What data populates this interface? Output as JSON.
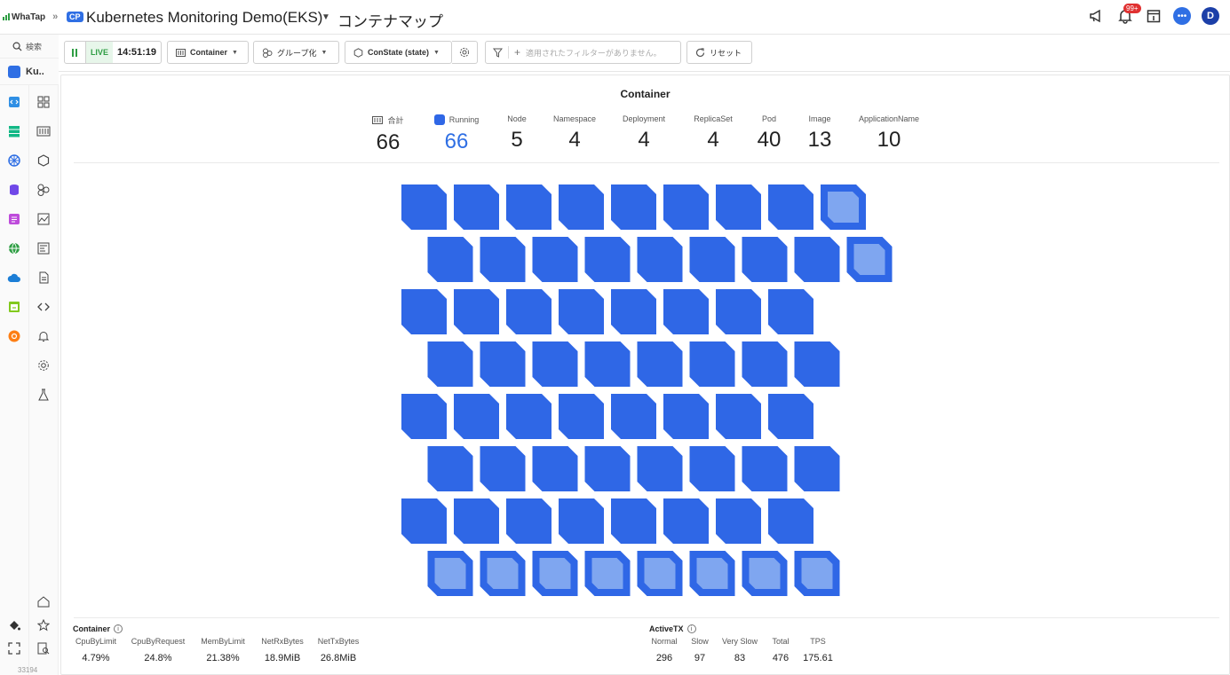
{
  "brand": {
    "logo_text": "WhaTap",
    "cp_badge": "CP"
  },
  "header": {
    "project_title": "Kubernetes Monitoring Demo(EKS)",
    "page_title": "コンテナマップ",
    "notification_count": "99+",
    "avatar_letter": "D"
  },
  "sidebar": {
    "search_label": "検索",
    "project_short": "Ku..",
    "footer_number": "33194"
  },
  "toolbar": {
    "live_label": "LIVE",
    "live_time": "14:51:19",
    "type_select": "Container",
    "group_select": "グループ化",
    "state_select": "ConState (state)",
    "filter_placeholder": "適用されたフィルターがありません。",
    "reset_label": "リセット"
  },
  "map": {
    "title": "Container",
    "stats": [
      {
        "label": "合計",
        "value": "66"
      },
      {
        "label": "Running",
        "value": "66"
      },
      {
        "label": "Node",
        "value": "5"
      },
      {
        "label": "Namespace",
        "value": "4"
      },
      {
        "label": "Deployment",
        "value": "4"
      },
      {
        "label": "ReplicaSet",
        "value": "4"
      },
      {
        "label": "Pod",
        "value": "40"
      },
      {
        "label": "Image",
        "value": "13"
      },
      {
        "label": "ApplicationName",
        "value": "10"
      }
    ],
    "rows": [
      {
        "count": 9,
        "highlighted": [
          8
        ]
      },
      {
        "count": 9,
        "highlighted": [
          8
        ]
      },
      {
        "count": 8,
        "highlighted": []
      },
      {
        "count": 8,
        "highlighted": []
      },
      {
        "count": 8,
        "highlighted": []
      },
      {
        "count": 8,
        "highlighted": []
      },
      {
        "count": 8,
        "highlighted": []
      },
      {
        "count": 8,
        "highlighted": [
          0,
          1,
          2,
          3,
          4,
          5,
          6,
          7
        ]
      }
    ],
    "colors": {
      "running": "#2f67e6",
      "highlight": "#7fa6f0"
    }
  },
  "container_metrics": {
    "title": "Container",
    "columns": [
      {
        "label": "CpuByLimit",
        "value": "4.79%"
      },
      {
        "label": "CpuByRequest",
        "value": "24.8%"
      },
      {
        "label": "MemByLimit",
        "value": "21.38%"
      },
      {
        "label": "NetRxBytes",
        "value": "18.9MiB"
      },
      {
        "label": "NetTxBytes",
        "value": "26.8MiB"
      }
    ]
  },
  "activetx_metrics": {
    "title": "ActiveTX",
    "columns": [
      {
        "label": "Normal",
        "value": "296"
      },
      {
        "label": "Slow",
        "value": "97"
      },
      {
        "label": "Very Slow",
        "value": "83"
      },
      {
        "label": "Total",
        "value": "476"
      },
      {
        "label": "TPS",
        "value": "175.61"
      }
    ]
  }
}
